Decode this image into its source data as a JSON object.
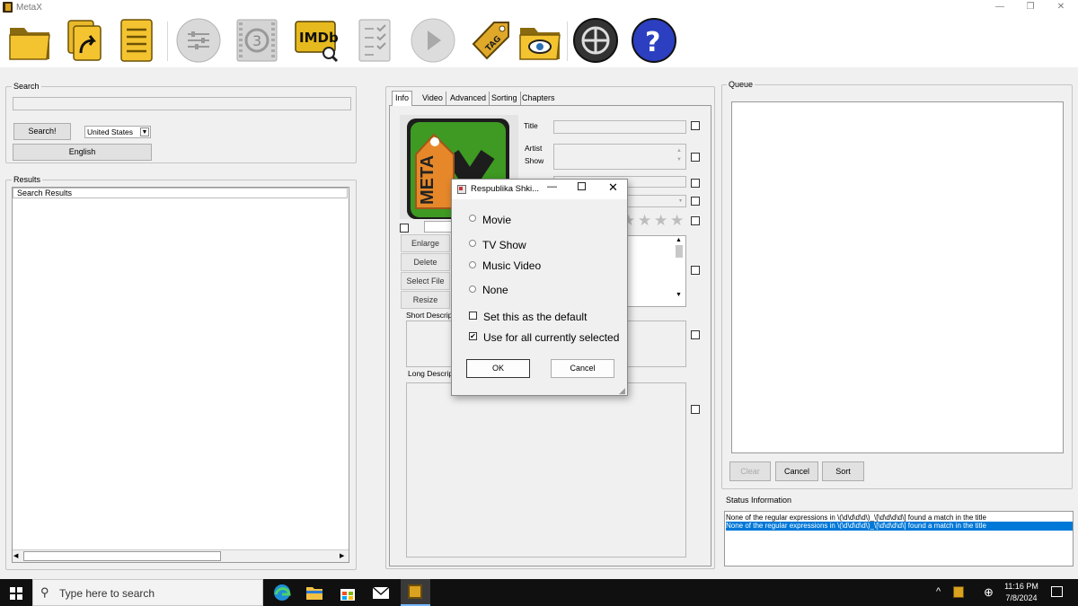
{
  "window": {
    "title": "MetaX",
    "min": "—",
    "max": "❐",
    "close": "✕"
  },
  "toolbar": {
    "icons": [
      "open-folder-icon",
      "import-icon",
      "file-list-icon",
      "settings-sliders-icon",
      "film-countdown-icon",
      "imdb-icon",
      "checklist-icon",
      "play-icon",
      "meta-tag-icon",
      "view-folder-icon",
      "film-reel-icon",
      "help-icon"
    ],
    "imdb_text": "IMDb"
  },
  "search": {
    "group_label": "Search",
    "input_value": "",
    "button": "Search!",
    "country": "United States",
    "language": "English"
  },
  "results": {
    "group_label": "Results",
    "column_header": "Search Results"
  },
  "tabs": [
    "Info",
    "Video",
    "Advanced",
    "Sorting",
    "Chapters"
  ],
  "info": {
    "title_label": "Title",
    "artist_label": "Artist",
    "show_label": "Show",
    "artwork_text": "META",
    "enlarge": "Enlarge",
    "delete": "Delete",
    "select_file": "Select File",
    "resize": "Resize",
    "short_desc_label": "Short Descript",
    "long_desc_label": "Long Descript"
  },
  "queue": {
    "group_label": "Queue",
    "clear": "Clear",
    "cancel": "Cancel",
    "sort": "Sort"
  },
  "status": {
    "label": "Status Information",
    "lines": [
      "None of the regular expressions in  \\(\\d\\d\\d\\d\\)_\\[\\d\\d\\d\\d\\] found a match in the title",
      "None of the regular expressions in  \\(\\d\\d\\d\\d\\)_\\[\\d\\d\\d\\d\\] found a match in the title"
    ]
  },
  "dialog": {
    "title": "Respublika Shki...",
    "options": [
      "Movie",
      "TV Show",
      "Music Video",
      "None"
    ],
    "set_default": "Set this as the default",
    "use_all": "Use for all currently selected",
    "use_all_checked": true,
    "set_default_checked": false,
    "ok": "OK",
    "cancel": "Cancel"
  },
  "taskbar": {
    "search_placeholder": "Type here to search",
    "time": "11:16 PM",
    "date": "7/8/2024"
  },
  "colors": {
    "accent": "#0078d7",
    "taskbar": "#101010",
    "selection": "#0078d7"
  }
}
